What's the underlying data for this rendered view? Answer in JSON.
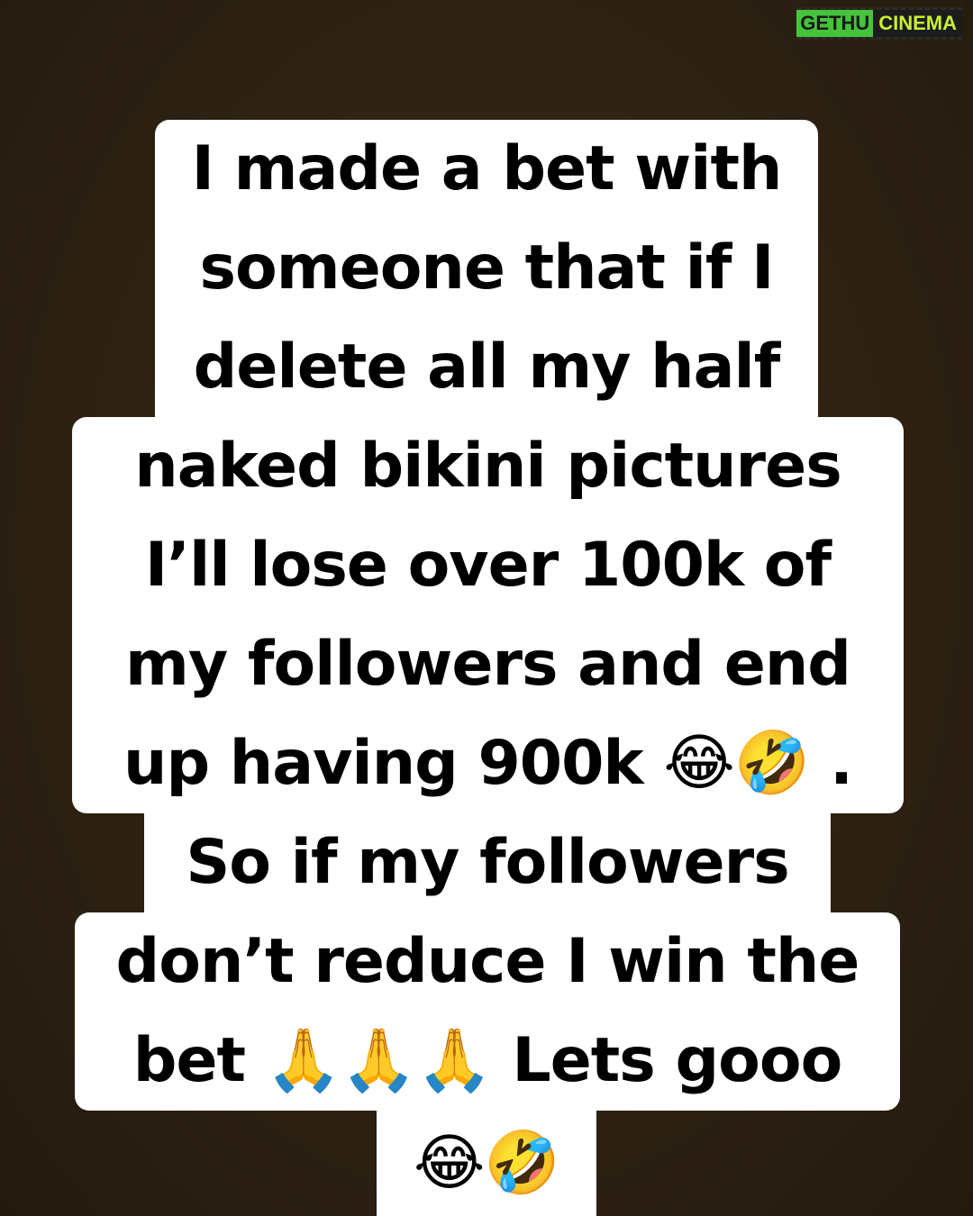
{
  "watermark": {
    "part1": "GETHU",
    "part2": "CINEMA"
  },
  "caption": {
    "lines": [
      "I made a bet with",
      "someone that if I",
      "delete all my half",
      "naked bikini pictures",
      "I’ll lose over 100k of",
      "my followers and end",
      "up having 900k 😂🤣 .",
      "So if my followers",
      "don’t reduce I win the",
      "bet 🙏🙏🙏 Lets gooo",
      "😂🤣"
    ]
  }
}
